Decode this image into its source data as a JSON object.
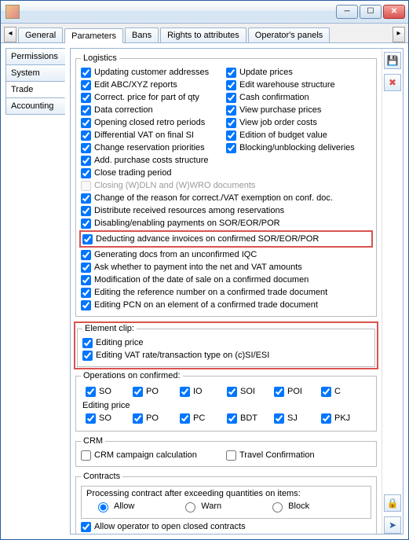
{
  "window": {
    "min_tip": "Minimize",
    "max_tip": "Maximize",
    "close_tip": "Close"
  },
  "tabs": {
    "general": "General",
    "parameters": "Parameters",
    "bans": "Bans",
    "rights": "Rights to attributes",
    "panels": "Operator's panels"
  },
  "side": {
    "permissions": "Permissions",
    "system": "System",
    "trade": "Trade",
    "accounting": "Accounting"
  },
  "logistics": {
    "legend": "Logistics",
    "left": {
      "upd_cust_addr": "Updating customer addresses",
      "edit_abc": "Edit ABC/XYZ reports",
      "correct_price": "Correct. price for part of qty",
      "data_corr": "Data correction",
      "open_closed_retro": "Opening closed retro periods",
      "diff_vat": "Differential VAT on final SI",
      "change_res_prio": "Change reservation priorities",
      "add_purch_costs": "Add. purchase costs structure",
      "close_trading": "Close trading period",
      "closing_wdln": "Closing (W)DLN and (W)WRO documents",
      "change_reason": "Change of the reason for correct./VAT exemption on conf. doc.",
      "distribute_res": "Distribute received resources among reservations",
      "disable_pay": "Disabling/enabling payments on SOR/EOR/POR",
      "deduct_adv": "Deducting advance invoices on confirmed SOR/EOR/POR",
      "gen_docs": "Generating docs from an unconfirmed IQC",
      "ask_payment": "Ask whether to payment into the net and VAT amounts",
      "mod_date_sale": "Modification of the date of sale on a confirmed documen",
      "edit_ref": "Editing the reference number on a confirmed trade document",
      "edit_pcn": "Editing PCN on an element of a confirmed trade document"
    },
    "right": {
      "update_prices": "Update prices",
      "edit_wh": "Edit warehouse structure",
      "cash_conf": "Cash confirmation",
      "view_purch": "View purchase prices",
      "view_job": "View job order costs",
      "edition_budget": "Edition of budget value",
      "block_unblock": "Blocking/unblocking deliveries"
    }
  },
  "element_clip": {
    "legend": "Element clip:",
    "editing_price": "Editing price",
    "editing_vat": "Editing VAT rate/transaction type on (c)SI/ESI"
  },
  "ops": {
    "legend": "Operations on confirmed:",
    "so": "SO",
    "po": "PO",
    "io": "IO",
    "soi": "SOI",
    "poi": "POI",
    "c": "C",
    "editing_price": "Editing price",
    "so2": "SO",
    "po2": "PO",
    "pc": "PC",
    "bdt": "BDT",
    "sj": "SJ",
    "pkj": "PKJ"
  },
  "crm": {
    "legend": "CRM",
    "campaign": "CRM campaign calculation",
    "travel": "Travel Confirmation"
  },
  "contracts": {
    "legend": "Contracts",
    "proc_legend": "Processing contract after exceeding quantities on items:",
    "allow": "Allow",
    "warn": "Warn",
    "block": "Block",
    "allow_open": "Allow operator to open closed contracts"
  },
  "rightbar": {
    "save": "Save",
    "delete": "Delete",
    "lock": "Lock",
    "pin": "Pin"
  }
}
